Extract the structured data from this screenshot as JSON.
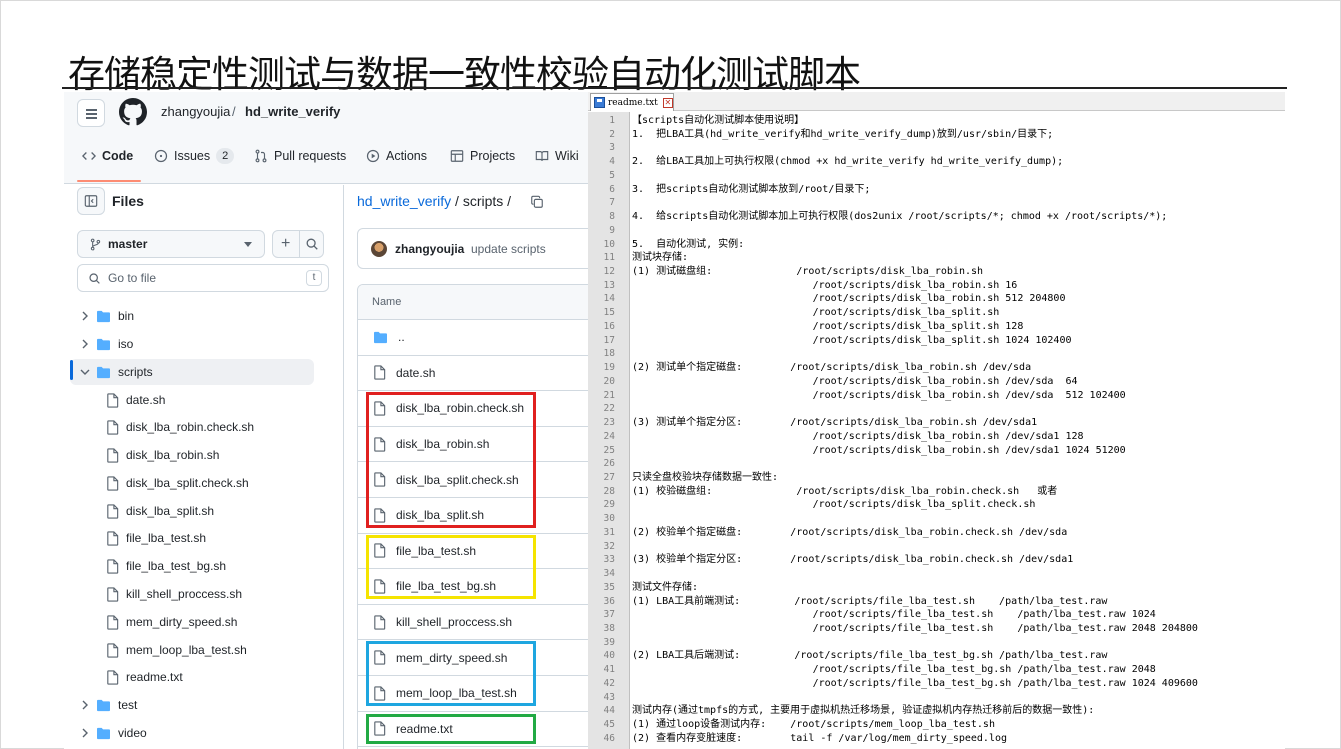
{
  "slide": {
    "title": "存储稳定性测试与数据一致性校验自动化测试脚本"
  },
  "github": {
    "owner": "zhangyoujia",
    "separator": "/",
    "repo": "hd_write_verify",
    "tabs": [
      {
        "label": "Code",
        "icon": "code-icon"
      },
      {
        "label": "Issues",
        "icon": "issue-icon",
        "count": "2"
      },
      {
        "label": "Pull requests",
        "icon": "pull-request-icon"
      },
      {
        "label": "Actions",
        "icon": "play-icon"
      },
      {
        "label": "Projects",
        "icon": "table-icon"
      },
      {
        "label": "Wiki",
        "icon": "book-icon"
      }
    ],
    "sidebar": {
      "title": "Files",
      "branch": "master",
      "goto_placeholder": "Go to file",
      "goto_shortcut": "t",
      "tree": [
        {
          "label": "bin",
          "type": "folder",
          "expanded": false
        },
        {
          "label": "iso",
          "type": "folder",
          "expanded": false
        },
        {
          "label": "scripts",
          "type": "folder",
          "expanded": true,
          "active": true
        },
        {
          "label": "date.sh",
          "type": "file"
        },
        {
          "label": "disk_lba_robin.check.sh",
          "type": "file"
        },
        {
          "label": "disk_lba_robin.sh",
          "type": "file"
        },
        {
          "label": "disk_lba_split.check.sh",
          "type": "file"
        },
        {
          "label": "disk_lba_split.sh",
          "type": "file"
        },
        {
          "label": "file_lba_test.sh",
          "type": "file"
        },
        {
          "label": "file_lba_test_bg.sh",
          "type": "file"
        },
        {
          "label": "kill_shell_proccess.sh",
          "type": "file"
        },
        {
          "label": "mem_dirty_speed.sh",
          "type": "file"
        },
        {
          "label": "mem_loop_lba_test.sh",
          "type": "file"
        },
        {
          "label": "readme.txt",
          "type": "file"
        },
        {
          "label": "test",
          "type": "folder",
          "expanded": false
        },
        {
          "label": "video",
          "type": "folder",
          "expanded": false
        }
      ]
    },
    "main": {
      "path_repo": "hd_write_verify",
      "path_rest": " / scripts /",
      "commit_author": "zhangyoujia",
      "commit_message": "update scripts",
      "column_header": "Name",
      "files": [
        {
          "label": "..",
          "type": "folder"
        },
        {
          "label": "date.sh",
          "type": "file"
        },
        {
          "label": "disk_lba_robin.check.sh",
          "type": "file"
        },
        {
          "label": "disk_lba_robin.sh",
          "type": "file"
        },
        {
          "label": "disk_lba_split.check.sh",
          "type": "file"
        },
        {
          "label": "disk_lba_split.sh",
          "type": "file"
        },
        {
          "label": "file_lba_test.sh",
          "type": "file"
        },
        {
          "label": "file_lba_test_bg.sh",
          "type": "file"
        },
        {
          "label": "kill_shell_proccess.sh",
          "type": "file"
        },
        {
          "label": "mem_dirty_speed.sh",
          "type": "file"
        },
        {
          "label": "mem_loop_lba_test.sh",
          "type": "file"
        },
        {
          "label": "readme.txt",
          "type": "file"
        }
      ],
      "highlight_colors": {
        "red": "#e0201f",
        "yellow": "#f5e400",
        "blue": "#1ea6e0",
        "green": "#22aa44"
      }
    }
  },
  "notepad": {
    "tab_label": "readme.txt",
    "lines": [
      {
        "n": "1",
        "t": "【scripts自动化测试脚本使用说明】"
      },
      {
        "n": "2",
        "t": "1.  把LBA工具(hd_write_verify和hd_write_verify_dump)放到/usr/sbin/目录下;"
      },
      {
        "n": "3",
        "t": ""
      },
      {
        "n": "4",
        "t": "2.  给LBA工具加上可执行权限(chmod +x hd_write_verify hd_write_verify_dump);"
      },
      {
        "n": "5",
        "t": ""
      },
      {
        "n": "6",
        "t": "3.  把scripts自动化测试脚本放到/root/目录下;"
      },
      {
        "n": "7",
        "t": ""
      },
      {
        "n": "8",
        "t": "4.  给scripts自动化测试脚本加上可执行权限(dos2unix /root/scripts/*; chmod +x /root/scripts/*);"
      },
      {
        "n": "9",
        "t": ""
      },
      {
        "n": "10",
        "t": "5.  自动化测试, 实例:"
      },
      {
        "n": "11",
        "t": "测试块存储:"
      },
      {
        "n": "12",
        "t": "(1) 测试磁盘组:              /root/scripts/disk_lba_robin.sh"
      },
      {
        "n": "13",
        "t": "                              /root/scripts/disk_lba_robin.sh 16"
      },
      {
        "n": "14",
        "t": "                              /root/scripts/disk_lba_robin.sh 512 204800"
      },
      {
        "n": "15",
        "t": "                              /root/scripts/disk_lba_split.sh"
      },
      {
        "n": "16",
        "t": "                              /root/scripts/disk_lba_split.sh 128"
      },
      {
        "n": "17",
        "t": "                              /root/scripts/disk_lba_split.sh 1024 102400"
      },
      {
        "n": "18",
        "t": ""
      },
      {
        "n": "19",
        "t": "(2) 测试单个指定磁盘:        /root/scripts/disk_lba_robin.sh /dev/sda"
      },
      {
        "n": "20",
        "t": "                              /root/scripts/disk_lba_robin.sh /dev/sda  64"
      },
      {
        "n": "21",
        "t": "                              /root/scripts/disk_lba_robin.sh /dev/sda  512 102400"
      },
      {
        "n": "22",
        "t": ""
      },
      {
        "n": "23",
        "t": "(3) 测试单个指定分区:        /root/scripts/disk_lba_robin.sh /dev/sda1"
      },
      {
        "n": "24",
        "t": "                              /root/scripts/disk_lba_robin.sh /dev/sda1 128"
      },
      {
        "n": "25",
        "t": "                              /root/scripts/disk_lba_robin.sh /dev/sda1 1024 51200"
      },
      {
        "n": "26",
        "t": ""
      },
      {
        "n": "27",
        "t": "只读全盘校验块存储数据一致性:"
      },
      {
        "n": "28",
        "t": "(1) 校验磁盘组:              /root/scripts/disk_lba_robin.check.sh   或者"
      },
      {
        "n": "29",
        "t": "                              /root/scripts/disk_lba_split.check.sh"
      },
      {
        "n": "30",
        "t": ""
      },
      {
        "n": "31",
        "t": "(2) 校验单个指定磁盘:        /root/scripts/disk_lba_robin.check.sh /dev/sda"
      },
      {
        "n": "32",
        "t": ""
      },
      {
        "n": "33",
        "t": "(3) 校验单个指定分区:        /root/scripts/disk_lba_robin.check.sh /dev/sda1"
      },
      {
        "n": "34",
        "t": ""
      },
      {
        "n": "35",
        "t": "测试文件存储:"
      },
      {
        "n": "36",
        "t": "(1) LBA工具前端测试:         /root/scripts/file_lba_test.sh    /path/lba_test.raw"
      },
      {
        "n": "37",
        "t": "                              /root/scripts/file_lba_test.sh    /path/lba_test.raw 1024"
      },
      {
        "n": "38",
        "t": "                              /root/scripts/file_lba_test.sh    /path/lba_test.raw 2048 204800"
      },
      {
        "n": "39",
        "t": ""
      },
      {
        "n": "40",
        "t": "(2) LBA工具后端测试:         /root/scripts/file_lba_test_bg.sh /path/lba_test.raw"
      },
      {
        "n": "41",
        "t": "                              /root/scripts/file_lba_test_bg.sh /path/lba_test.raw 2048"
      },
      {
        "n": "42",
        "t": "                              /root/scripts/file_lba_test_bg.sh /path/lba_test.raw 1024 409600"
      },
      {
        "n": "43",
        "t": ""
      },
      {
        "n": "44",
        "t": "测试内存(通过tmpfs的方式, 主要用于虚拟机热迁移场景, 验证虚拟机内存热迁移前后的数据一致性):"
      },
      {
        "n": "45",
        "t": "(1) 通过loop设备测试内存:    /root/scripts/mem_loop_lba_test.sh"
      },
      {
        "n": "46",
        "t": "(2) 查看内存变脏速度:        tail -f /var/log/mem_dirty_speed.log"
      }
    ]
  }
}
